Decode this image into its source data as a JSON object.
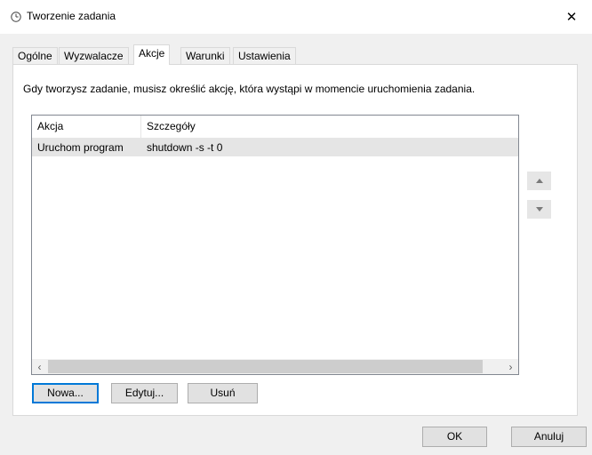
{
  "window": {
    "title": "Tworzenie zadania",
    "close_icon": "close-icon",
    "title_icon": "clock-icon"
  },
  "tabs": [
    {
      "label": "Ogólne",
      "active": false
    },
    {
      "label": "Wyzwalacze",
      "active": false
    },
    {
      "label": "Akcje",
      "active": true
    },
    {
      "label": "Warunki",
      "active": false
    },
    {
      "label": "Ustawienia",
      "active": false
    }
  ],
  "actions_panel": {
    "description": "Gdy tworzysz zadanie, musisz określić akcję, która wystąpi w momencie uruchomienia zadania.",
    "columns": [
      "Akcja",
      "Szczegóły"
    ],
    "rows": [
      {
        "action": "Uruchom program",
        "details": "shutdown -s -t 0"
      }
    ],
    "scroll_left_icon": "chevron-left-icon",
    "scroll_right_icon": "chevron-right-icon",
    "move_up_icon": "triangle-up-icon",
    "move_down_icon": "triangle-down-icon",
    "buttons": {
      "new": "Nowa...",
      "edit": "Edytuj...",
      "delete": "Usuń"
    }
  },
  "dialog_buttons": {
    "ok": "OK",
    "cancel": "Anuluj"
  }
}
